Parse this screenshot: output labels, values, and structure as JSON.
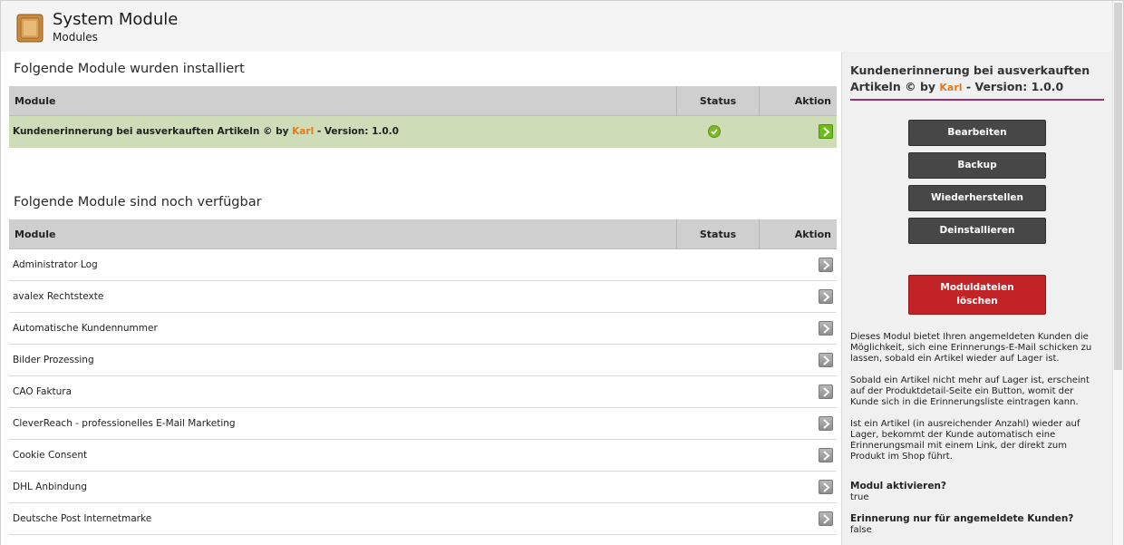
{
  "header": {
    "title": "System Module",
    "subtitle": "Modules",
    "icon": "box-icon"
  },
  "installed": {
    "heading": "Folgende Module wurden installiert",
    "columns": {
      "module": "Module",
      "status": "Status",
      "aktion": "Aktion"
    },
    "rows": [
      {
        "name": "Kundenerinnerung bei ausverkauften Artikeln © by",
        "author": "Karl",
        "suffix": "- Version: 1.0.0",
        "status": "installed"
      }
    ]
  },
  "available": {
    "heading": "Folgende Module sind noch verfügbar",
    "columns": {
      "module": "Module",
      "status": "Status",
      "aktion": "Aktion"
    },
    "rows": [
      "Administrator Log",
      "avalex Rechtstexte",
      "Automatische Kundennummer",
      "Bilder Prozessing",
      "CAO Faktura",
      "CleverReach - professionelles E-Mail Marketing",
      "Cookie Consent",
      "DHL Anbindung",
      "Deutsche Post Internetmarke"
    ]
  },
  "sidebar": {
    "title_a": "Kundenerinnerung bei ausverkauften Artikeln © by",
    "title_author": "Karl",
    "title_b": "- Version: 1.0.0",
    "buttons": {
      "edit": "Bearbeiten",
      "backup": "Backup",
      "restore": "Wiederherstellen",
      "uninstall": "Deinstallieren",
      "delete_l1": "Moduldateien",
      "delete_l2": "löschen"
    },
    "desc_1": "Dieses Modul bietet Ihren angemeldeten Kunden die Möglichkeit, sich eine Erinnerungs-E-Mail schicken zu lassen, sobald ein Artikel wieder auf Lager ist.",
    "desc_2": "Sobald ein Artikel nicht mehr auf Lager ist, erscheint auf der Produktdetail-Seite ein Button, womit der Kunde sich in die Erinnerungsliste eintragen kann.",
    "desc_3": "Ist ein Artikel (in ausreichender Anzahl) wieder auf Lager, bekommt der Kunde automatisch eine Erinnerungsmail mit einem Link, der direkt zum Produkt im Shop führt.",
    "setting_1_label": "Modul aktivieren?",
    "setting_1_value": "true",
    "setting_2_label": "Erinnerung nur für angemeldete Kunden?",
    "setting_2_value": "false"
  },
  "colors": {
    "active_row": "#cfdcb8",
    "accent_rule": "#9d2f6e",
    "author": "#e07b1f",
    "danger": "#c22326"
  }
}
